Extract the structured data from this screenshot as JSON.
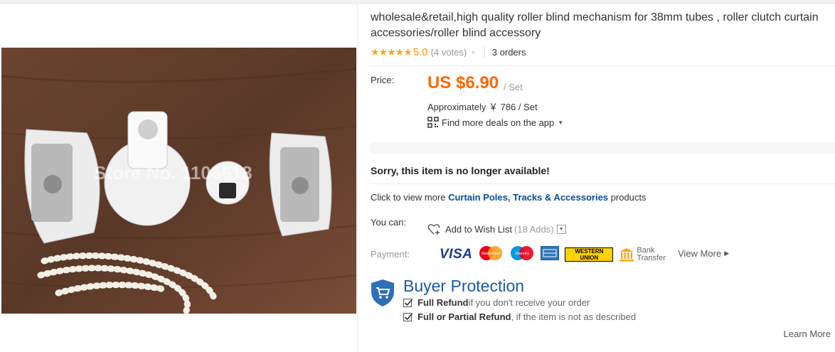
{
  "product": {
    "title": "wholesale&retail,high quality roller blind mechanism for 38mm tubes , roller clutch curtain accessories/roller blind accessory",
    "stars": "★★★★★",
    "rating": "5.0",
    "votes": "(4 votes)",
    "orders": "3 orders",
    "watermark": "Store No. 1106618"
  },
  "price": {
    "label": "Price:",
    "amount": "US $6.90",
    "unit": "/ Set",
    "approx": "Approximately ￥ 786 / Set",
    "app_deals": "Find more deals on the app"
  },
  "availability": {
    "sorry": "Sorry, this item is no longer available!",
    "click_prefix": "Click to view more ",
    "category_link": "Curtain Poles, Tracks & Accessories",
    "click_suffix": " products"
  },
  "actions": {
    "you_can_label": "You can:",
    "wishlist_label": "Add to Wish List",
    "wishlist_count": "(18 Adds)"
  },
  "payment": {
    "label": "Payment:",
    "visa": "VISA",
    "mastercard": "MasterCard",
    "maestro": "Maestro",
    "western_union": "WESTERN UNION",
    "bank_transfer_line1": "Bank",
    "bank_transfer_line2": "Transfer",
    "view_more": "View More"
  },
  "buyer_protection": {
    "title": "Buyer Protection",
    "line1_bold": "Full Refund",
    "line1_rest": " if you don't receive your order",
    "line2_bold": "Full or Partial Refund",
    "line2_rest": " , if the item is not as described",
    "learn_more": "Learn More"
  },
  "colors": {
    "price": "#ff6600",
    "link": "#0b4a9a",
    "protection": "#1b5aa8",
    "star": "#f5a623"
  }
}
